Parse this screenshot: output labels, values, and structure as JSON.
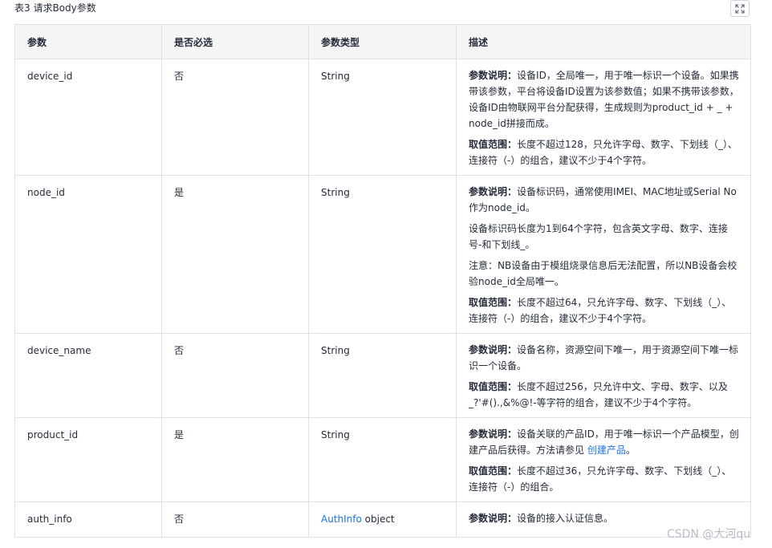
{
  "caption": "表3 请求Body参数",
  "expand_icon": "expand-icon",
  "headers": [
    "参数",
    "是否必选",
    "参数类型",
    "描述"
  ],
  "rows": [
    {
      "param": "device_id",
      "required": "否",
      "type": "String",
      "desc": [
        {
          "label": "参数说明",
          "colon": "：",
          "text": "设备ID，全局唯一，用于唯一标识一个设备。如果携带该参数，平台将设备ID设置为该参数值；如果不携带该参数，设备ID由物联网平台分配获得，生成规则为product_id + _ + node_id拼接而成。"
        },
        {
          "label": "取值范围",
          "colon": "：",
          "text": "长度不超过128，只允许字母、数字、下划线（_）、连接符（-）的组合，建议不少于4个字符。"
        }
      ]
    },
    {
      "param": "node_id",
      "required": "是",
      "type": "String",
      "desc": [
        {
          "label": "参数说明",
          "colon": "：",
          "text": "设备标识码，通常使用IMEI、MAC地址或Serial No作为node_id。"
        },
        {
          "text": "设备标识码长度为1到64个字符，包含英文字母、数字、连接号-和下划线_。"
        },
        {
          "text": "注意：NB设备由于模组烧录信息后无法配置，所以NB设备会校验node_id全局唯一。"
        },
        {
          "label": "取值范围",
          "colon": "：",
          "text": "长度不超过64，只允许字母、数字、下划线（_）、连接符（-）的组合，建议不少于4个字符。"
        }
      ]
    },
    {
      "param": "device_name",
      "required": "否",
      "type": "String",
      "desc": [
        {
          "label": "参数说明",
          "colon": "：",
          "text": "设备名称，资源空间下唯一，用于资源空间下唯一标识一个设备。"
        },
        {
          "label": "取值范围",
          "colon": "：",
          "text": "长度不超过256，只允许中文、字母、数字、以及_?'#().,&%@!-等字符的组合，建议不少于4个字符。"
        }
      ]
    },
    {
      "param": "product_id",
      "required": "是",
      "type": "String",
      "desc": [
        {
          "label": "参数说明",
          "colon": "：",
          "text": "设备关联的产品ID，用于唯一标识一个产品模型，创建产品后获得。方法请参见 ",
          "link": "创建产品",
          "after": "。"
        },
        {
          "label": "取值范围",
          "colon": "：",
          "text": "长度不超过36，只允许字母、数字、下划线（_）、连接符（-）的组合。"
        }
      ]
    },
    {
      "param": "auth_info",
      "required": "否",
      "type_link": "AuthInfo",
      "type_suffix": " object",
      "desc": [
        {
          "label": "参数说明",
          "colon": "：",
          "text": "设备的接入认证信息。"
        }
      ]
    }
  ],
  "watermark": "CSDN @大河qu",
  "colors": {
    "link": "#1a73e8",
    "header_bg": "#f5f5f6",
    "border": "#dfe1e6",
    "text": "#252b3a"
  }
}
